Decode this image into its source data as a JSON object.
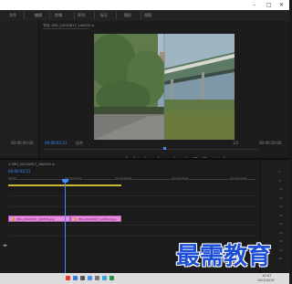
{
  "window": {
    "minimize": "–",
    "maximize": "□",
    "close": "✕"
  },
  "menu": {
    "items": [
      "文件",
      "编辑",
      "剪辑",
      "序列",
      "标记",
      "图形",
      "视图"
    ]
  },
  "program": {
    "tab": "节目: IMG_20220817_164503 ≡",
    "timecode_current": "00:00:02:51",
    "fit_label": "适合",
    "quality_label": "1/2",
    "timecode_duration": "00:00:10:00"
  },
  "source": {
    "timecode": "00:00:00:00"
  },
  "transport": [
    "▸",
    "{",
    "}",
    "|◂",
    "◂|",
    "▶",
    "|▸",
    "▸|",
    "⊞",
    "⊟",
    "◉",
    "⚐",
    "+"
  ],
  "timeline": {
    "tab": "× IMG_20220817_164503 ≡",
    "timecode": "00:00:02:51",
    "ruler_labels": [
      "00:00",
      "00:00:05:00",
      "00:00:10:00",
      "00:00:15:00",
      "00:00:20:00"
    ],
    "clips": [
      {
        "name": "IMG_20220817_164503.jpg"
      },
      {
        "name": "IMG_20220817_164512.jpg"
      }
    ]
  },
  "meter": {
    "ticks": [
      "0",
      "-6",
      "-12",
      "-18",
      "-24",
      "-30",
      "-36",
      "-42",
      "-48",
      "-54",
      "dB"
    ]
  },
  "taskbar": {
    "time": "10:47",
    "date": "2021/10/19"
  },
  "watermark": "最需教育",
  "colors": {
    "accent": "#3d8bff",
    "clip": "#e58ee0",
    "workarea": "#c9b836",
    "watermark": "#1d4fd6"
  }
}
